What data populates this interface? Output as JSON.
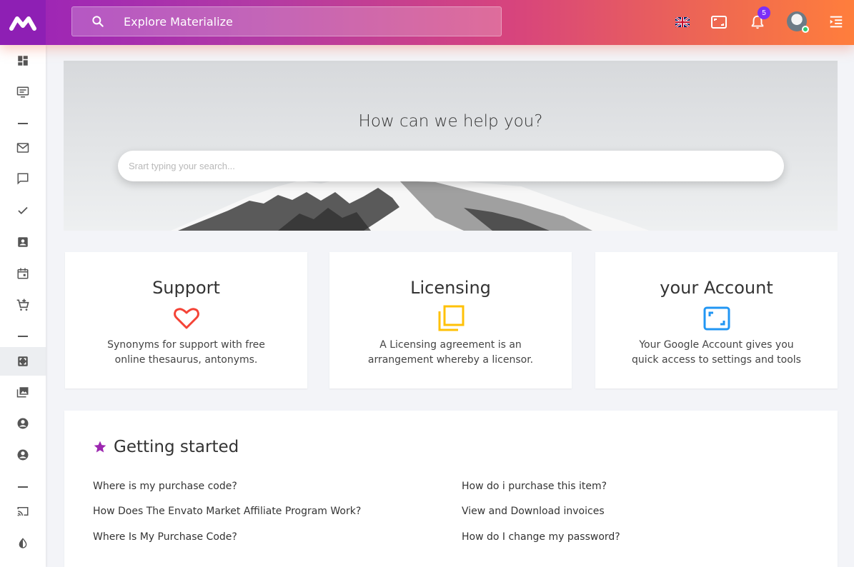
{
  "header": {
    "search_label": "Explore Materialize",
    "notification_count": "5"
  },
  "hero": {
    "title": "How can we help you?",
    "search_placeholder": "Srart typing your search..."
  },
  "cards": [
    {
      "title": "Support",
      "text_line1": "Synonyms for support with free",
      "text_line2": "online thesaurus, antonyms.",
      "icon": "heart-icon",
      "color": "#f44336"
    },
    {
      "title": "Licensing",
      "text_line1": "A Licensing agreement is an",
      "text_line2": "arrangement whereby a licensor.",
      "icon": "copy-icon",
      "color": "#ffc107"
    },
    {
      "title": "your Account",
      "text_line1": "Your Google Account gives you",
      "text_line2": "quick access to settings and tools",
      "icon": "fullscreen-icon",
      "color": "#2196f3"
    }
  ],
  "getting_started": {
    "title": "Getting started",
    "star_color": "#9c27b0",
    "links_left": [
      "Where is my purchase code?",
      "How Does The Envato Market Affiliate Program Work?",
      "Where Is My Purchase Code?"
    ],
    "links_right": [
      "How do i purchase this item?",
      "View and Download invoices",
      "How do I change my password?"
    ]
  },
  "sidebar": {
    "icons": [
      "dashboard-icon",
      "monitor-icon",
      "mail-icon",
      "chat-icon",
      "check-icon",
      "contacts-icon",
      "calendar-icon",
      "cart-icon",
      "fullscreen-icon",
      "photo-library-icon",
      "account-circle-icon",
      "account-circle-icon",
      "cast-icon",
      "contrast-icon"
    ]
  }
}
